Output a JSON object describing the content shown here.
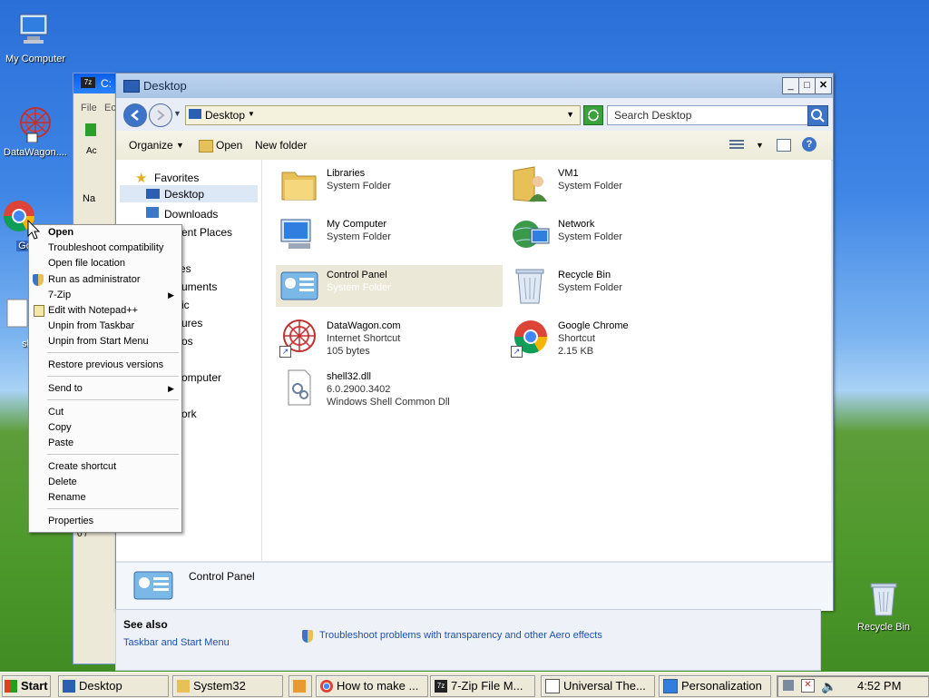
{
  "desktop": {
    "icons": [
      {
        "label": "My Computer",
        "icon": "my-computer-icon"
      },
      {
        "label": "DataWagon....",
        "icon": "datawagon-icon"
      },
      {
        "label": "Google",
        "icon": "chrome-icon"
      },
      {
        "label": "she",
        "icon": "shell-file-icon"
      },
      {
        "label": "Recycle Bin",
        "icon": "recycle-bin-icon"
      }
    ]
  },
  "window": {
    "title": "Desktop",
    "address": "Desktop",
    "search_placeholder": "Search Desktop",
    "commands": {
      "organize": "Organize",
      "open": "Open",
      "new_folder": "New folder"
    },
    "nav": {
      "favorites": "Favorites",
      "desktop": "Desktop",
      "downloads": "Downloads",
      "recent": "ent Places",
      "partial": [
        "es",
        "uments",
        "ic",
        "ures",
        "os",
        "omputer",
        "ork"
      ]
    },
    "items": [
      {
        "name": "Libraries",
        "line2": "System Folder",
        "line3": "",
        "icon": "libraries-icon"
      },
      {
        "name": "VM1",
        "line2": "System Folder",
        "line3": "",
        "icon": "user-folder-icon"
      },
      {
        "name": "My Computer",
        "line2": "System Folder",
        "line3": "",
        "icon": "computer-icon"
      },
      {
        "name": "Network",
        "line2": "System Folder",
        "line3": "",
        "icon": "network-icon"
      },
      {
        "name": "Control Panel",
        "line2": "System Folder",
        "line3": "",
        "icon": "control-panel-icon"
      },
      {
        "name": "Recycle Bin",
        "line2": "System Folder",
        "line3": "",
        "icon": "recycle-bin-icon"
      },
      {
        "name": "DataWagon.com",
        "line2": "Internet Shortcut",
        "line3": "105 bytes",
        "icon": "datawagon-icon"
      },
      {
        "name": "Google Chrome",
        "line2": "Shortcut",
        "line3": "2.15 KB",
        "icon": "chrome-icon"
      },
      {
        "name": "shell32.dll",
        "line2": "6.0.2900.3402",
        "line3": "Windows Shell Common Dll",
        "icon": "dll-icon"
      }
    ],
    "details_name": "Control Panel"
  },
  "see_also": {
    "heading": "See also",
    "link1": "Taskbar and Start Menu",
    "link2": "Troubleshoot problems with transparency and other Aero effects"
  },
  "bg_window": {
    "title": "C:",
    "menu": [
      "File",
      "Ec"
    ],
    "toolbar": "Ac",
    "col": "Na",
    "status": "0 /"
  },
  "context_menu": {
    "items": [
      "Open",
      "Troubleshoot compatibility",
      "Open file location",
      "Run as administrator",
      "7-Zip",
      "Edit with Notepad++",
      "Unpin from Taskbar",
      "Unpin from Start Menu",
      "Restore previous versions",
      "Send to",
      "Cut",
      "Copy",
      "Paste",
      "Create shortcut",
      "Delete",
      "Rename",
      "Properties"
    ]
  },
  "taskbar": {
    "start": "Start",
    "buttons": [
      "Desktop",
      "System32",
      "",
      "How to make ...",
      "7-Zip File M...",
      "Universal The...",
      "Personalization"
    ],
    "clock": "4:52 PM"
  }
}
